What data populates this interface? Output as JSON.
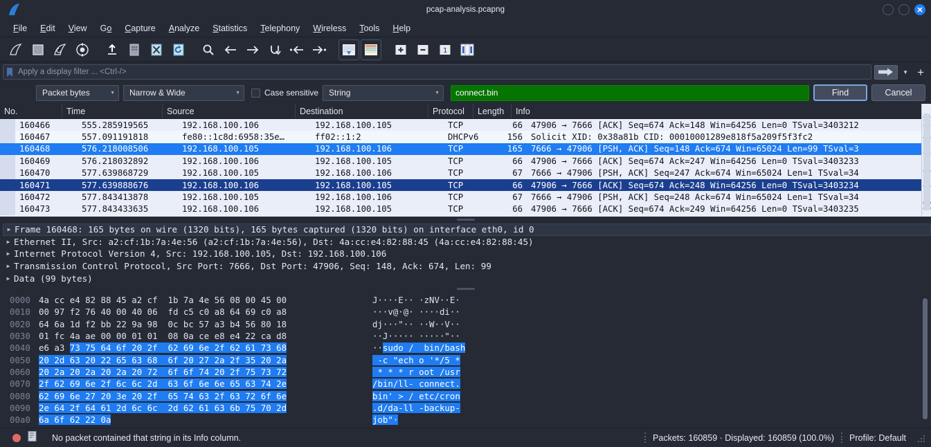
{
  "window": {
    "title": "pcap-analysis.pcapng",
    "logo_icon": "wireshark-fin-icon",
    "controls": [
      {
        "name": "minimize-button",
        "label": ""
      },
      {
        "name": "maximize-button",
        "label": ""
      },
      {
        "name": "close-button",
        "label": "✕"
      }
    ]
  },
  "menu": [
    {
      "label": "File",
      "mnemonic": "F"
    },
    {
      "label": "Edit",
      "mnemonic": "E"
    },
    {
      "label": "View",
      "mnemonic": "V"
    },
    {
      "label": "Go",
      "mnemonic": "G"
    },
    {
      "label": "Capture",
      "mnemonic": "C"
    },
    {
      "label": "Analyze",
      "mnemonic": "A"
    },
    {
      "label": "Statistics",
      "mnemonic": "S"
    },
    {
      "label": "Telephony",
      "mnemonic": "T"
    },
    {
      "label": "Wireless",
      "mnemonic": "W"
    },
    {
      "label": "Tools",
      "mnemonic": "T"
    },
    {
      "label": "Help",
      "mnemonic": "H"
    }
  ],
  "toolbar": [
    {
      "name": "start-capture-icon",
      "title": "Start capturing packets"
    },
    {
      "name": "stop-capture-icon",
      "title": "Stop capturing packets"
    },
    {
      "name": "restart-capture-icon",
      "title": "Restart current capture"
    },
    {
      "name": "capture-options-icon",
      "title": "Capture options"
    },
    {
      "name": "open-file-icon",
      "title": "Open a capture file"
    },
    {
      "name": "save-file-icon",
      "title": "Save this capture file"
    },
    {
      "name": "close-file-icon",
      "title": "Close this capture file"
    },
    {
      "name": "reload-file-icon",
      "title": "Reload this file"
    },
    {
      "name": "find-packet-icon",
      "title": "Find a packet"
    },
    {
      "name": "go-back-icon",
      "title": "Go back in packet history"
    },
    {
      "name": "go-forward-icon",
      "title": "Go forward in packet history"
    },
    {
      "name": "go-to-packet-icon",
      "title": "Go to the packet"
    },
    {
      "name": "go-to-first-packet-icon",
      "title": "Go to the first packet"
    },
    {
      "name": "go-to-last-packet-icon",
      "title": "Go to the last packet"
    },
    {
      "name": "auto-scroll-icon",
      "title": "Auto scroll in live capture"
    },
    {
      "name": "colorize-packets-icon",
      "title": "Colorize packet list"
    },
    {
      "name": "zoom-in-icon",
      "title": "Zoom in"
    },
    {
      "name": "zoom-out-icon",
      "title": "Zoom out"
    },
    {
      "name": "zoom-reset-icon",
      "title": "Normal size"
    },
    {
      "name": "resize-columns-icon",
      "title": "Resize columns"
    }
  ],
  "display_filter": {
    "placeholder": "Apply a display filter ... <Ctrl-/>",
    "value": "",
    "bookmark_icon": "bookmark-icon",
    "apply_icon": "arrow-right-icon",
    "dropdown_icon": "chevron-down-icon",
    "add_button_label": "+"
  },
  "find_bar": {
    "search_in": "Packet bytes",
    "char_width": "Narrow & Wide",
    "case_sensitive_label": "Case sensitive",
    "case_sensitive_checked": false,
    "display_type": "String",
    "search_value": "connect.bin",
    "search_field_color": "#057400",
    "find_label": "Find",
    "cancel_label": "Cancel"
  },
  "packet_list": {
    "columns": [
      {
        "label": "No."
      },
      {
        "label": "Time"
      },
      {
        "label": "Source"
      },
      {
        "label": "Destination"
      },
      {
        "label": "Protocol"
      },
      {
        "label": "Length"
      },
      {
        "label": "Info"
      }
    ],
    "rows": [
      {
        "no": "160466",
        "time": "555.285919565",
        "src": "192.168.100.106",
        "dst": "192.168.100.105",
        "proto": "TCP",
        "len": "66",
        "info": "47906 → 7666 [ACK] Seq=674 Ack=148 Win=64256 Len=0 TSval=3403212",
        "state": "alt"
      },
      {
        "no": "160467",
        "time": "557.091191818",
        "src": "fe80::1c8d:6958:35e…",
        "dst": "ff02::1:2",
        "proto": "DHCPv6",
        "len": "156",
        "info": "Solicit XID: 0x38a81b CID: 00010001289e818f5a209f5f3fc2",
        "state": "light"
      },
      {
        "no": "160468",
        "time": "576.218008506",
        "src": "192.168.100.105",
        "dst": "192.168.100.106",
        "proto": "TCP",
        "len": "165",
        "info": "7666 → 47906 [PSH, ACK] Seq=148 Ack=674 Win=65024 Len=99 TSval=3",
        "state": "sel"
      },
      {
        "no": "160469",
        "time": "576.218032892",
        "src": "192.168.100.106",
        "dst": "192.168.100.105",
        "proto": "TCP",
        "len": "66",
        "info": "47906 → 7666 [ACK] Seq=674 Ack=247 Win=64256 Len=0 TSval=3403233",
        "state": "alt"
      },
      {
        "no": "160470",
        "time": "577.639868729",
        "src": "192.168.100.105",
        "dst": "192.168.100.106",
        "proto": "TCP",
        "len": "67",
        "info": "7666 → 47906 [PSH, ACK] Seq=247 Ack=674 Win=65024 Len=1 TSval=34",
        "state": "alt"
      },
      {
        "no": "160471",
        "time": "577.639888676",
        "src": "192.168.100.106",
        "dst": "192.168.100.105",
        "proto": "TCP",
        "len": "66",
        "info": "47906 → 7666 [ACK] Seq=674 Ack=248 Win=64256 Len=0 TSval=3403234",
        "state": "sel2"
      },
      {
        "no": "160472",
        "time": "577.843413878",
        "src": "192.168.100.105",
        "dst": "192.168.100.106",
        "proto": "TCP",
        "len": "67",
        "info": "7666 → 47906 [PSH, ACK] Seq=248 Ack=674 Win=65024 Len=1 TSval=34",
        "state": "alt"
      },
      {
        "no": "160473",
        "time": "577.843433635",
        "src": "192.168.100.106",
        "dst": "192.168.100.105",
        "proto": "TCP",
        "len": "66",
        "info": "47906 → 7666 [ACK] Seq=674 Ack=249 Win=64256 Len=0 TSval=3403235",
        "state": "alt"
      }
    ]
  },
  "packet_details": [
    {
      "text": "Frame 160468: 165 bytes on wire (1320 bits), 165 bytes captured (1320 bits) on interface eth0, id 0",
      "selected": true
    },
    {
      "text": "Ethernet II, Src: a2:cf:1b:7a:4e:56 (a2:cf:1b:7a:4e:56), Dst: 4a:cc:e4:82:88:45 (4a:cc:e4:82:88:45)",
      "selected": false
    },
    {
      "text": "Internet Protocol Version 4, Src: 192.168.100.105, Dst: 192.168.100.106",
      "selected": false
    },
    {
      "text": "Transmission Control Protocol, Src Port: 7666, Dst Port: 47906, Seq: 148, Ack: 674, Len: 99",
      "selected": false
    },
    {
      "text": "Data (99 bytes)",
      "selected": false
    }
  ],
  "hex_dump": {
    "rows": [
      {
        "offset": "0000",
        "bytes_plain": "4a cc e4 82 88 45 a2 cf  1b 7a 4e 56 08 00 45 00",
        "bytes_hl": "",
        "ascii_plain": "J····E·· ·zNV··E·",
        "ascii_hl": ""
      },
      {
        "offset": "0010",
        "bytes_plain": "00 97 f2 76 40 00 40 06  fd c5 c0 a8 64 69 c0 a8",
        "bytes_hl": "",
        "ascii_plain": "···v@·@· ····di··",
        "ascii_hl": ""
      },
      {
        "offset": "0020",
        "bytes_plain": "64 6a 1d f2 bb 22 9a 98  0c bc 57 a3 b4 56 80 18",
        "bytes_hl": "",
        "ascii_plain": "dj···\"·· ··W··V··",
        "ascii_hl": ""
      },
      {
        "offset": "0030",
        "bytes_plain": "01 fc 4a ae 00 00 01 01  08 0a ce e8 e4 22 ca d8",
        "bytes_hl": "",
        "ascii_plain": "··J····· ·····\"··",
        "ascii_hl": ""
      },
      {
        "offset": "0040",
        "bytes_plain": "e6 a3 ",
        "bytes_hl": "73 75 64 6f 20 2f  62 69 6e 2f 62 61 73 68",
        "ascii_plain": "··",
        "ascii_hl": "sudo /  bin/bash"
      },
      {
        "offset": "0050",
        "bytes_plain": "",
        "bytes_hl": "20 2d 63 20 22 65 63 68  6f 20 27 2a 2f 35 20 2a",
        "ascii_plain": "",
        "ascii_hl": " -c \"ech o '*/5 *"
      },
      {
        "offset": "0060",
        "bytes_plain": "",
        "bytes_hl": "20 2a 20 2a 20 2a 20 72  6f 6f 74 20 2f 75 73 72",
        "ascii_plain": "",
        "ascii_hl": " * * * r oot /usr"
      },
      {
        "offset": "0070",
        "bytes_plain": "",
        "bytes_hl": "2f 62 69 6e 2f 6c 6c 2d  63 6f 6e 6e 65 63 74 2e",
        "ascii_plain": "",
        "ascii_hl": "/bin/ll- connect."
      },
      {
        "offset": "0080",
        "bytes_plain": "",
        "bytes_hl": "62 69 6e 27 20 3e 20 2f  65 74 63 2f 63 72 6f 6e",
        "ascii_plain": "",
        "ascii_hl": "bin' > / etc/cron"
      },
      {
        "offset": "0090",
        "bytes_plain": "",
        "bytes_hl": "2e 64 2f 64 61 2d 6c 6c  2d 62 61 63 6b 75 70 2d",
        "ascii_plain": "",
        "ascii_hl": ".d/da-ll -backup-"
      },
      {
        "offset": "00a0",
        "bytes_plain": "",
        "bytes_hl": "6a 6f 62 22 0a",
        "ascii_plain": "",
        "ascii_hl": "job\"·"
      }
    ],
    "highlight_color": "#1f7cf2"
  },
  "status_bar": {
    "expert_icon": "expert-info-dot-icon",
    "capture_file_icon": "capture-file-properties-icon",
    "message": "No packet contained that string in its Info column.",
    "packets": "Packets: 160859 · Displayed: 160859 (100.0%)",
    "profile": "Profile: Default"
  }
}
